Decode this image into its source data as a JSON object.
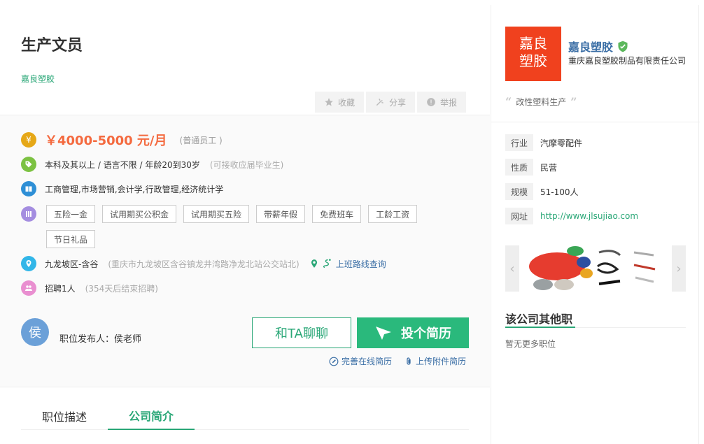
{
  "job": {
    "title": "生产文员",
    "company_link": "嘉良塑胶",
    "actions": {
      "favorite": "收藏",
      "share": "分享",
      "report": "举报"
    },
    "salary": "￥4000-5000 元/月",
    "salary_note": "(普通员工 )",
    "requirements": "本科及其以上 / 语言不限 / 年龄20到30岁",
    "requirements_note": "(可接收应届毕业生)",
    "majors": "工商管理,市场营销,会计学,行政管理,经济统计学",
    "benefits": [
      "五险一金",
      "试用期买公积金",
      "试用期买五险",
      "带薪年假",
      "免费班车",
      "工龄工资",
      "节日礼品"
    ],
    "location": "九龙坡区-含谷",
    "address": "(重庆市九龙坡区含谷镇龙井湾路净龙北站公交站北)",
    "route_label": "上班路线查询",
    "headcount": "招聘1人",
    "headcount_note": "(354天后结束招聘)",
    "publisher_avatar": "侯",
    "publisher": "职位发布人：侯老师",
    "chat_label": "和TA聊聊",
    "apply_label": "投个简历",
    "complete_resume": "完善在线简历",
    "upload_resume": "上传附件简历",
    "tabs": [
      "职位描述",
      "公司简介"
    ]
  },
  "company": {
    "logo_line1": "嘉良",
    "logo_line2": "塑胶",
    "name": "嘉良塑胶",
    "full_name": "重庆嘉良塑胶制品有限责任公司",
    "slogan": "改性塑料生产",
    "info": [
      {
        "label": "行业",
        "value": "汽摩零配件"
      },
      {
        "label": "性质",
        "value": "民营"
      },
      {
        "label": "规模",
        "value": "51-100人"
      },
      {
        "label": "网址",
        "value": "http://www.jlsujiao.com"
      }
    ],
    "other_jobs_title": "该公司其他职",
    "other_jobs_empty": "暂无更多职位"
  },
  "colors": {
    "accent": "#2aa777",
    "salary": "#f46a3f",
    "logo_bg": "#f0411e",
    "link": "#3a6ea5"
  }
}
